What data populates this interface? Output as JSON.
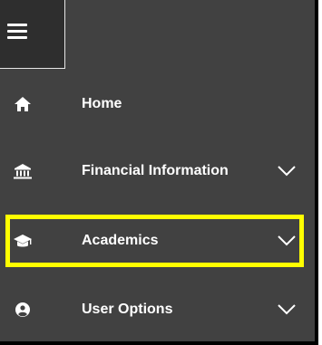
{
  "menu": {
    "toggle_icon": "hamburger-menu-icon",
    "items": [
      {
        "label": "Home",
        "icon": "home-icon",
        "expandable": false
      },
      {
        "label": "Financial Information",
        "icon": "bank-icon",
        "expandable": true
      },
      {
        "label": "Academics",
        "icon": "graduation-cap-icon",
        "expandable": true,
        "highlighted": true
      },
      {
        "label": "User Options",
        "icon": "user-circle-icon",
        "expandable": true
      }
    ]
  },
  "colors": {
    "background": "#414141",
    "text": "#ffffff",
    "highlight": "#ffff00",
    "border": "#000000"
  }
}
